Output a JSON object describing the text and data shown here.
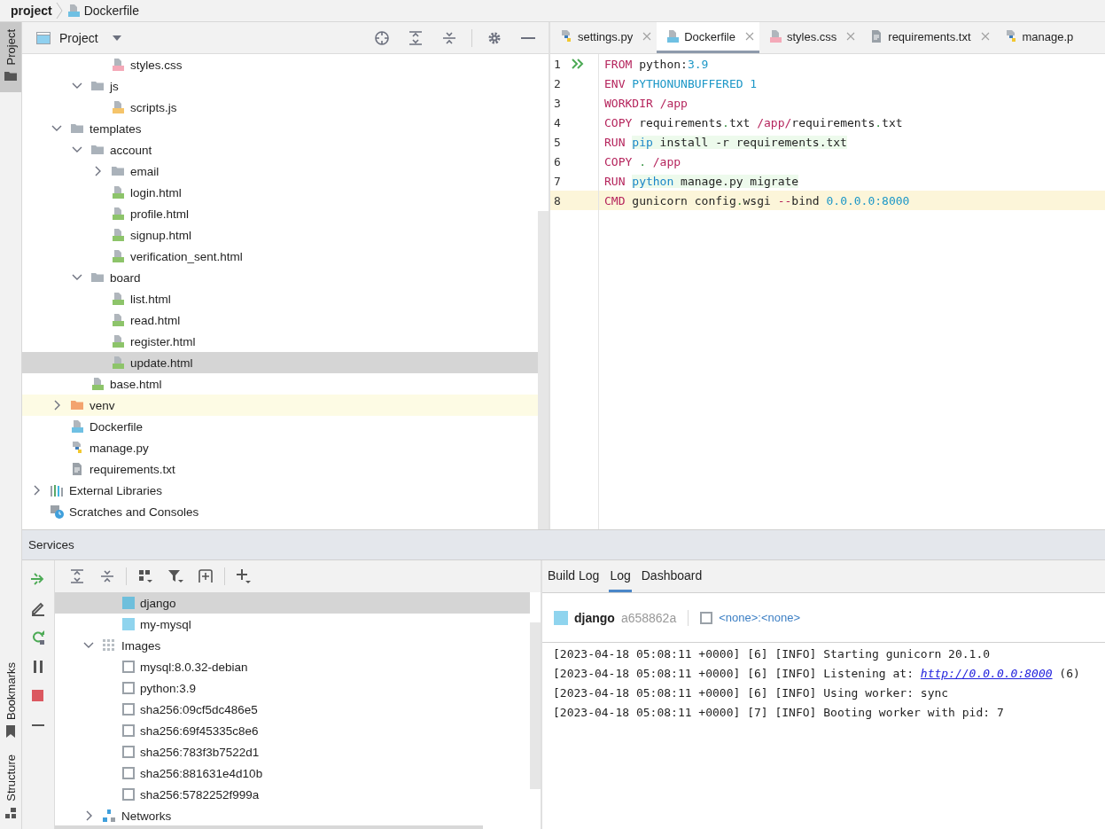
{
  "breadcrumb": [
    {
      "label": "project",
      "kind": "folder"
    },
    {
      "label": "Dockerfile",
      "kind": "docker"
    }
  ],
  "side_tabs": {
    "top": [
      {
        "label": "Project",
        "selected": true
      }
    ],
    "bottom": [
      {
        "label": "Bookmarks",
        "selected": false
      },
      {
        "label": "Structure",
        "selected": false
      }
    ]
  },
  "project_panel": {
    "title": "Project",
    "tree": [
      {
        "children": [
          {
            "children": [
              {
                "children": [
                  {
                    "label": "styles.css",
                    "kind": "css",
                    "selected": false
                  }
                ]
              },
              {
                "label": "js",
                "kind": "folder",
                "expanded": true,
                "selected": false,
                "children": [
                  {
                    "label": "scripts.js",
                    "kind": "js",
                    "selected": false
                  }
                ]
              }
            ]
          },
          {
            "label": "templates",
            "kind": "folder",
            "expanded": true,
            "selected": false,
            "children": [
              {
                "label": "account",
                "kind": "folder",
                "expanded": true,
                "selected": false,
                "children": [
                  {
                    "label": "email",
                    "kind": "folder",
                    "expanded": false,
                    "selected": false
                  },
                  {
                    "label": "login.html",
                    "kind": "html",
                    "selected": false
                  },
                  {
                    "label": "profile.html",
                    "kind": "html",
                    "selected": false
                  },
                  {
                    "label": "signup.html",
                    "kind": "html",
                    "selected": false
                  },
                  {
                    "label": "verification_sent.html",
                    "kind": "html",
                    "selected": false
                  }
                ]
              },
              {
                "label": "board",
                "kind": "folder",
                "expanded": true,
                "selected": false,
                "children": [
                  {
                    "label": "list.html",
                    "kind": "html",
                    "selected": false
                  },
                  {
                    "label": "read.html",
                    "kind": "html",
                    "selected": false
                  },
                  {
                    "label": "register.html",
                    "kind": "html",
                    "selected": false
                  },
                  {
                    "label": "update.html",
                    "kind": "html",
                    "selected": true
                  }
                ]
              },
              {
                "label": "base.html",
                "kind": "html",
                "selected": false
              }
            ]
          },
          {
            "label": "venv",
            "kind": "excluded-folder",
            "expanded": false,
            "selected": false
          },
          {
            "label": "Dockerfile",
            "kind": "docker",
            "selected": false
          },
          {
            "label": "manage.py",
            "kind": "python",
            "selected": false
          },
          {
            "label": "requirements.txt",
            "kind": "text",
            "selected": false
          }
        ]
      },
      {
        "label": "External Libraries",
        "kind": "libraries",
        "expanded": false,
        "selected": false
      },
      {
        "label": "Scratches and Consoles",
        "kind": "scratches",
        "selected": false
      }
    ]
  },
  "editor": {
    "tabs": [
      {
        "label": "settings.py",
        "kind": "python",
        "selected": false
      },
      {
        "label": "Dockerfile",
        "kind": "docker",
        "selected": true
      },
      {
        "label": "styles.css",
        "kind": "css",
        "selected": false
      },
      {
        "label": "requirements.txt",
        "kind": "text",
        "selected": false
      },
      {
        "label": "manage.p",
        "kind": "python",
        "selected": false
      }
    ],
    "lines": [
      {
        "number": "1",
        "run": true,
        "current": false,
        "tokens": [
          {
            "text": "FROM",
            "kind": "kw"
          },
          {
            "text": " python:",
            "kind": "plain"
          },
          {
            "text": "3.9",
            "kind": "num"
          }
        ]
      },
      {
        "number": "2",
        "run": false,
        "current": false,
        "tokens": [
          {
            "text": "ENV ",
            "kind": "kw"
          },
          {
            "text": "PYTHONUNBUFFERED 1",
            "kind": "num"
          }
        ]
      },
      {
        "number": "3",
        "run": false,
        "current": false,
        "tokens": [
          {
            "text": "WORKDIR ",
            "kind": "kw"
          },
          {
            "text": "/app",
            "kind": "path"
          }
        ]
      },
      {
        "number": "4",
        "run": false,
        "current": false,
        "tokens": [
          {
            "text": "COPY",
            "kind": "kw"
          },
          {
            "text": " requirements",
            "kind": "plain"
          },
          {
            "text": ".",
            "kind": "dot"
          },
          {
            "text": "txt ",
            "kind": "plain"
          },
          {
            "text": "/app/",
            "kind": "path"
          },
          {
            "text": "requirements",
            "kind": "plain"
          },
          {
            "text": ".",
            "kind": "dot"
          },
          {
            "text": "txt",
            "kind": "plain"
          }
        ]
      },
      {
        "number": "5",
        "run": false,
        "current": false,
        "tokens": [
          {
            "text": "RUN ",
            "kind": "kw"
          },
          {
            "text": "pip",
            "kind": "cmd",
            "injected": true
          },
          {
            "text": " install -r requirements.txt",
            "kind": "plain",
            "injected": true
          }
        ]
      },
      {
        "number": "6",
        "run": false,
        "current": false,
        "tokens": [
          {
            "text": "COPY ",
            "kind": "kw"
          },
          {
            "text": ".",
            "kind": "dot"
          },
          {
            "text": " /app",
            "kind": "path"
          }
        ]
      },
      {
        "number": "7",
        "run": false,
        "current": false,
        "tokens": [
          {
            "text": "RUN ",
            "kind": "kw"
          },
          {
            "text": "python",
            "kind": "cmd",
            "injected": true
          },
          {
            "text": " manage.py migrate",
            "kind": "plain",
            "injected": true
          }
        ]
      },
      {
        "number": "8",
        "run": false,
        "current": true,
        "tokens": [
          {
            "text": "CMD",
            "kind": "kw"
          },
          {
            "text": " gunicorn config",
            "kind": "plain"
          },
          {
            "text": ".",
            "kind": "dot"
          },
          {
            "text": "wsgi ",
            "kind": "plain"
          },
          {
            "text": "--",
            "kind": "path"
          },
          {
            "text": "bind ",
            "kind": "plain"
          },
          {
            "text": "0.0.0.0",
            "kind": "num"
          },
          {
            "text": ":8000",
            "kind": "num"
          }
        ]
      }
    ]
  },
  "services": {
    "title": "Services",
    "tree": [
      {
        "children": [
          {
            "children": [
              {
                "label": "django",
                "kind": "container",
                "color": "#6ebfdc",
                "selected": true
              },
              {
                "label": "my-mysql",
                "kind": "container",
                "color": "#8fd4ee",
                "selected": false
              }
            ]
          },
          {
            "label": "Images",
            "kind": "images",
            "expanded": true,
            "selected": false,
            "children": [
              {
                "label": "mysql:8.0.32-debian",
                "kind": "image",
                "selected": false
              },
              {
                "label": "python:3.9",
                "kind": "image",
                "selected": false
              },
              {
                "label": "sha256:09cf5dc486e5",
                "kind": "image",
                "selected": false
              },
              {
                "label": "sha256:69f45335c8e6",
                "kind": "image",
                "selected": false
              },
              {
                "label": "sha256:783f3b7522d1",
                "kind": "image",
                "selected": false
              },
              {
                "label": "sha256:881631e4d10b",
                "kind": "image",
                "selected": false
              },
              {
                "label": "sha256:5782252f999a",
                "kind": "image",
                "selected": false
              }
            ]
          },
          {
            "label": "Networks",
            "kind": "networks",
            "expanded": false,
            "selected": false
          }
        ]
      }
    ],
    "detail": {
      "tabs": [
        {
          "label": "Build Log",
          "selected": false
        },
        {
          "label": "Log",
          "selected": true
        },
        {
          "label": "Dashboard",
          "selected": false
        }
      ],
      "container": {
        "name": "django",
        "id": "a658862a",
        "image": "<none>:<none>"
      },
      "log": [
        {
          "text": "[2023-04-18 05:08:11 +0000] [6] [INFO] Starting gunicorn 20.1.0"
        },
        {
          "text": "[2023-04-18 05:08:11 +0000] [6] [INFO] Listening at: ",
          "link": "http://0.0.0.0:8000",
          "after": " (6)"
        },
        {
          "text": "[2023-04-18 05:08:11 +0000] [6] [INFO] Using worker: sync"
        },
        {
          "text": "[2023-04-18 05:08:11 +0000] [7] [INFO] Booting worker with pid: 7"
        }
      ]
    }
  }
}
